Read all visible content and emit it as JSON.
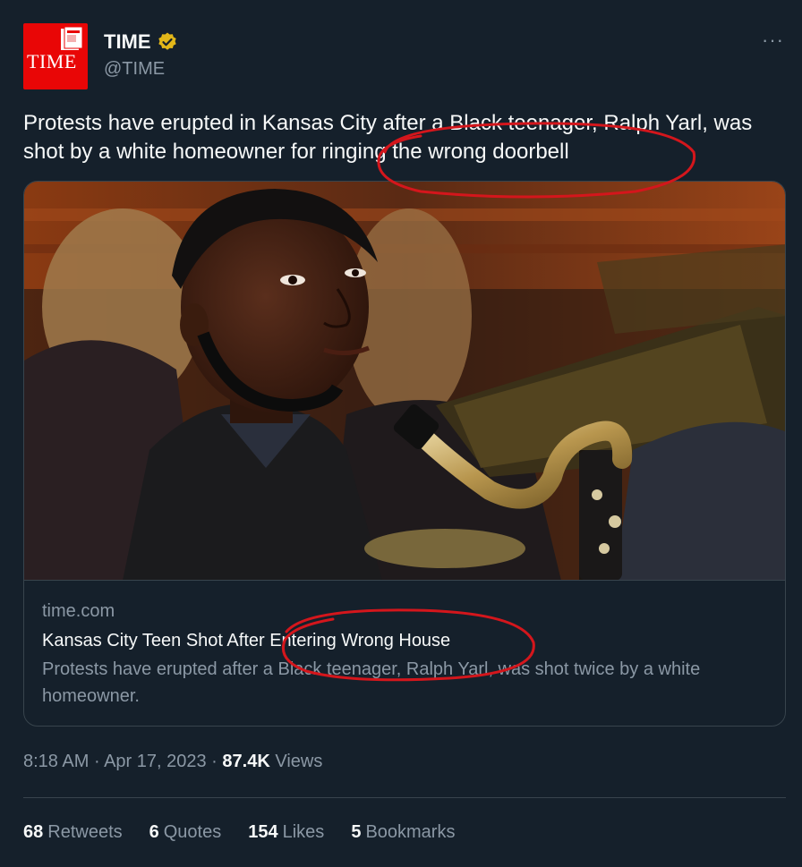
{
  "account": {
    "avatar_text": "TIME",
    "name": "TIME",
    "handle": "@TIME",
    "verified_icon": "verified-badge-icon",
    "more_icon": "more-options-icon",
    "more_glyph": "···"
  },
  "tweet": {
    "text": "Protests have erupted in Kansas City after a Black teenager, Ralph Yarl, was shot by a white homeowner for ringing the wrong doorbell"
  },
  "card": {
    "domain": "time.com",
    "title": "Kansas City Teen Shot After Entering Wrong House",
    "description": "Protests have erupted after a Black teenager, Ralph Yarl, was shot twice by a white homeowner."
  },
  "meta": {
    "time": "8:18 AM",
    "date": "Apr 17, 2023",
    "views_count": "87.4K",
    "views_label": "Views",
    "separator": "·"
  },
  "stats": [
    {
      "count": "68",
      "label": "Retweets"
    },
    {
      "count": "6",
      "label": "Quotes"
    },
    {
      "count": "154",
      "label": "Likes"
    },
    {
      "count": "5",
      "label": "Bookmarks"
    }
  ],
  "colors": {
    "background": "#15202b",
    "brand_red": "#e90606",
    "annotation_red": "#d4161c",
    "verified_gold": "#e2b719",
    "secondary_text": "#8b98a5"
  }
}
